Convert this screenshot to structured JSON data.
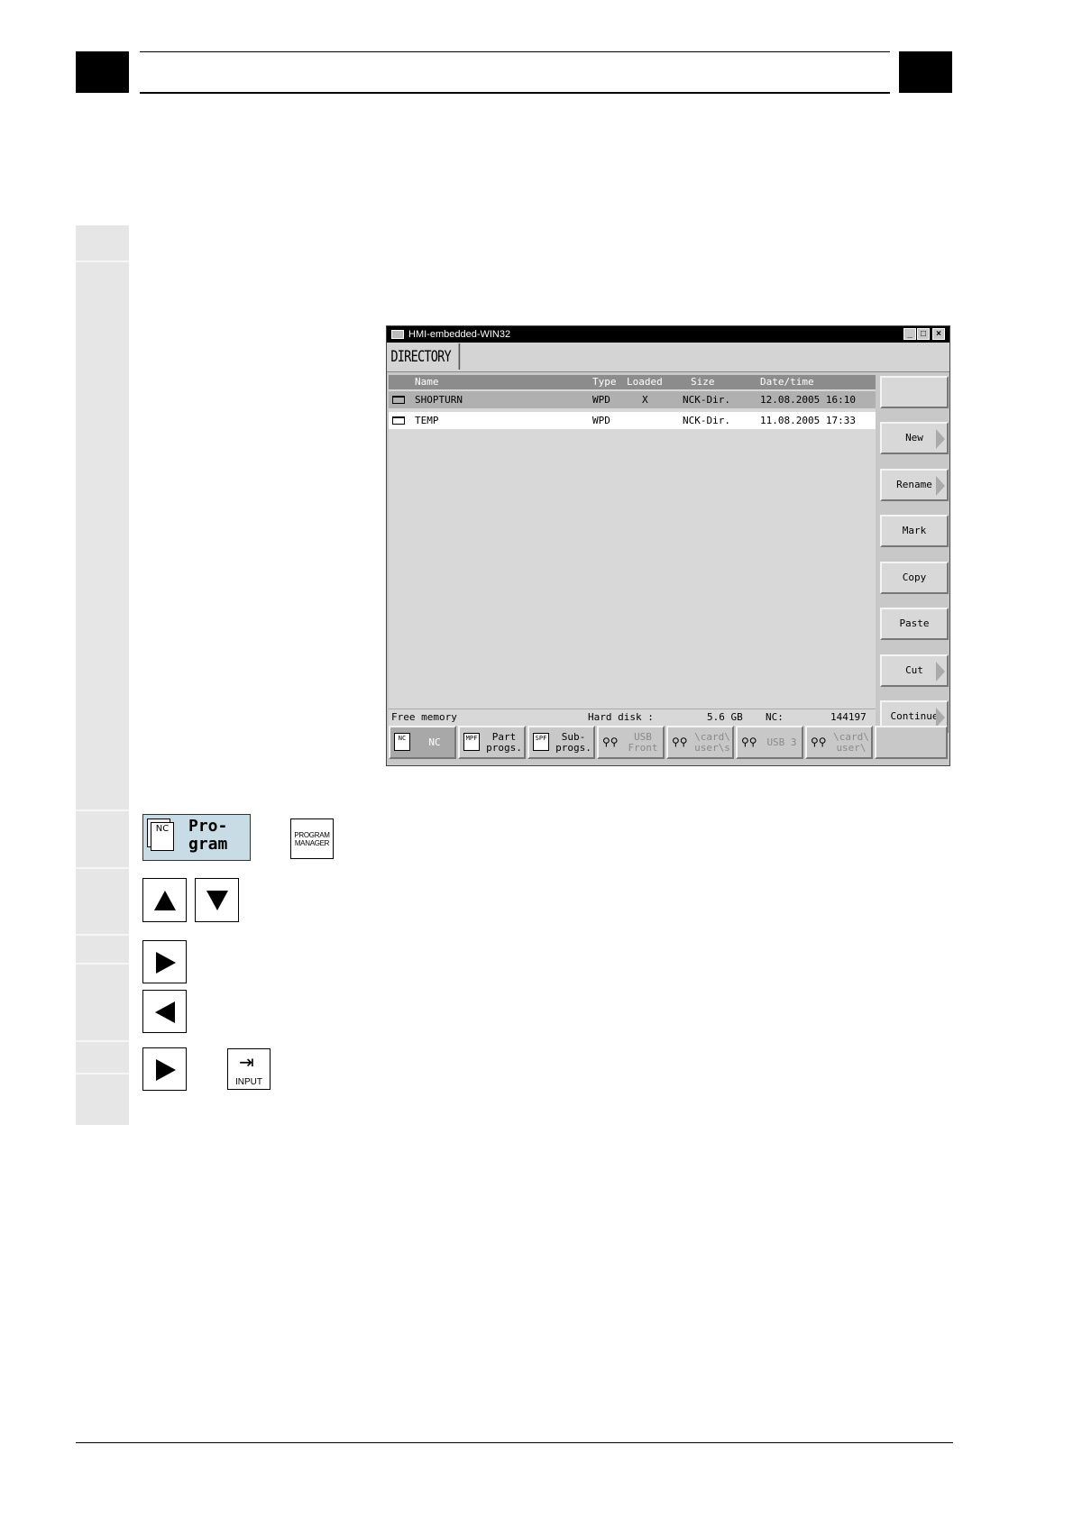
{
  "window": {
    "title": "HMI-embedded-WIN32",
    "minimize": "_",
    "maximize": "□",
    "close": "×"
  },
  "heading": "DIRECTORY",
  "columns": {
    "name": "Name",
    "type": "Type",
    "loaded": "Loaded",
    "size": "Size",
    "datetime": "Date/time"
  },
  "rows": [
    {
      "name": "SHOPTURN",
      "type": "WPD",
      "loaded": "X",
      "size": "NCK-Dir.",
      "datetime": "12.08.2005 16:10"
    },
    {
      "name": "TEMP",
      "type": "WPD",
      "loaded": "",
      "size": "NCK-Dir.",
      "datetime": "11.08.2005 17:33"
    }
  ],
  "status": {
    "free_memory": "Free memory",
    "hard_disk_label": "Hard disk :",
    "hard_disk_value": "5.6 GB",
    "nc_label": "NC:",
    "nc_value": "144197"
  },
  "vertical_softkeys": [
    "",
    "New",
    "Rename",
    "Mark",
    "Copy",
    "Paste",
    "Cut",
    "Continue"
  ],
  "horizontal_softkeys": [
    {
      "icon": "NC",
      "line1": "NC",
      "line2": ""
    },
    {
      "icon": "MPF",
      "line1": "Part",
      "line2": "progs."
    },
    {
      "icon": "SPF",
      "line1": "Sub-",
      "line2": "progs."
    },
    {
      "icon": "usb",
      "line1": "USB",
      "line2": "Front"
    },
    {
      "icon": "usb",
      "line1": "\\card\\",
      "line2": "user\\s"
    },
    {
      "icon": "usb",
      "line1": "USB 3",
      "line2": ""
    },
    {
      "icon": "usb",
      "line1": "\\card\\",
      "line2": "user\\"
    },
    {
      "icon": "",
      "line1": "",
      "line2": ""
    }
  ],
  "keys": {
    "program_softkey_icon": "NC",
    "program_softkey_line1": "Pro-",
    "program_softkey_line2": "gram",
    "program_manager_line1": "PROGRAM",
    "program_manager_line2": "MANAGER",
    "input_key": "INPUT"
  }
}
